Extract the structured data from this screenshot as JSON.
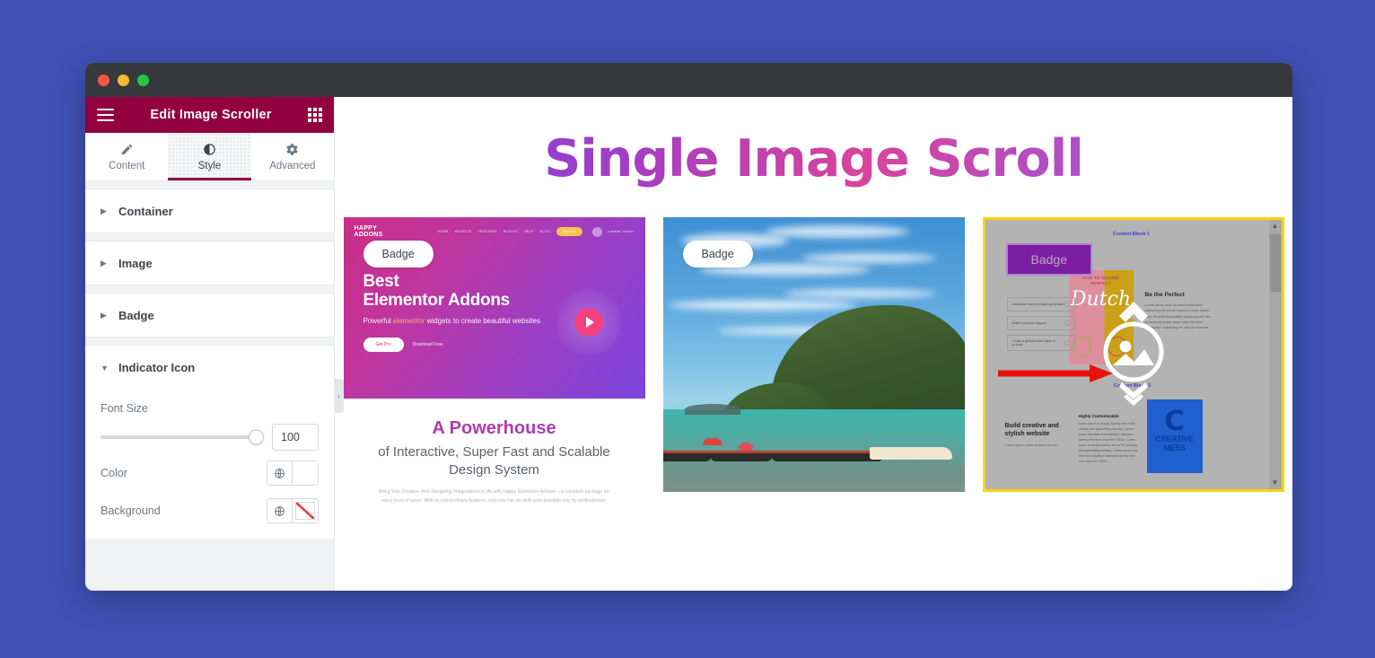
{
  "window": {
    "traffic_lights": [
      "close",
      "minimize",
      "maximize"
    ]
  },
  "panel": {
    "title": "Edit Image Scroller",
    "menu_icon": "hamburger-icon",
    "widgets_icon": "grid-icon",
    "tabs": [
      {
        "label": "Content",
        "icon": "pencil-icon",
        "active": false
      },
      {
        "label": "Style",
        "icon": "contrast-icon",
        "active": true
      },
      {
        "label": "Advanced",
        "icon": "gear-icon",
        "active": false
      }
    ],
    "sections": [
      {
        "label": "Container",
        "open": false
      },
      {
        "label": "Image",
        "open": false
      },
      {
        "label": "Badge",
        "open": false
      },
      {
        "label": "Indicator Icon",
        "open": true
      }
    ],
    "indicator_icon_controls": {
      "font_size": {
        "label": "Font Size",
        "value": "100",
        "slider_percent": 100
      },
      "color": {
        "label": "Color",
        "globe_icon": "globe-icon",
        "swatch": "#ffffff"
      },
      "background": {
        "label": "Background",
        "globe_icon": "globe-icon",
        "swatch": "none"
      }
    },
    "collapse_handle": "‹"
  },
  "canvas": {
    "page_title": "Single Image Scroll",
    "title_gradient": [
      "#7b3fe4",
      "#d8449b"
    ],
    "cards": [
      {
        "badge": "Badge",
        "badge_style": "white-pill",
        "screenshot": {
          "brand_line1": "HAPPY",
          "brand_line2": "ADDONS",
          "nav_items": [
            "HOME",
            "WIDGETS",
            "FEATURES",
            "BLOCKS",
            "HELP",
            "BLOG"
          ],
          "nav_cta": "MyLead",
          "account_name": "kobatas Yonder",
          "heading_line1": "Best",
          "heading_line2": "Elementor Addons",
          "subheading_pre": "Powerful ",
          "subheading_em": "elementor",
          "subheading_post": " widgets to create beautiful websites",
          "btn_primary": "Get Pro",
          "btn_secondary": "Download Free",
          "play_icon": "play-icon"
        },
        "caption": {
          "title": "A Powerhouse",
          "subtitle": "of Interactive, Super Fast and Scalable Design System",
          "body": "Bring Your Creative Web Designing Imaginations to life with Happy Elementor Addons – a complete package for every level of users. With its extraordinary features, now you can do stuff once possible only by professionals."
        }
      },
      {
        "badge": "Badge",
        "badge_style": "white-pill",
        "screenshot": {
          "kind": "photo",
          "description": "tropical bay with long-tail boats and green mountain"
        }
      },
      {
        "badge": "Badge",
        "badge_style": "purple-box",
        "selected": true,
        "border_color": "#ffd400",
        "indicator_icon": {
          "name": "image-scroll-indicator",
          "parts": [
            "chevron-up",
            "image-circle",
            "chevron-down"
          ],
          "color": "#ffffff"
        },
        "annotation_arrow": {
          "color": "#e8110c",
          "direction": "right"
        },
        "scrollbar": {
          "up": "▲",
          "down": "▼",
          "thumb_position": "top"
        },
        "mockup": {
          "label_top": "Content Block 1",
          "label_mid": "Content Block 2",
          "poster_head": "HOW TO SECURE",
          "poster_head2": "PERFECT",
          "poster_word": "Dutch",
          "features": [
            "Innovation dan pionirajcb generation",
            "Better customer support",
            "Create a global brand value of product"
          ],
          "right_title": "Be the Perfect",
          "right_body": "Lorem ipsum dolor sit amet consectetur adipiscing elit sed do eiusmod Lorem ipsum dolor sit amet consectetur adipiscing elit, sed do eiusmod power ipsum dolor sit amet consectetur adipiscing elit, sed do eiusmod",
          "lower_title": "Build creative and stylish website",
          "lower_body": "Lorem ipsum dolor sit amet sed do",
          "mid_title": "Highly Customizable",
          "mid_body": "Lorem ipsum is simply dummy text of the printing and typesetting industry. Lorem Ipsum has been the industry's standard dummy text ever since the 1500s. Lorem Ipsum is simply dummy text of the printing and typesetting industry. Lorem Ipsum has been the industry's standard dummy text ever since the 1500s.",
          "poster2_letter": "C",
          "poster2_line1": "CREATIVE",
          "poster2_line2": "MESS"
        }
      }
    ]
  }
}
